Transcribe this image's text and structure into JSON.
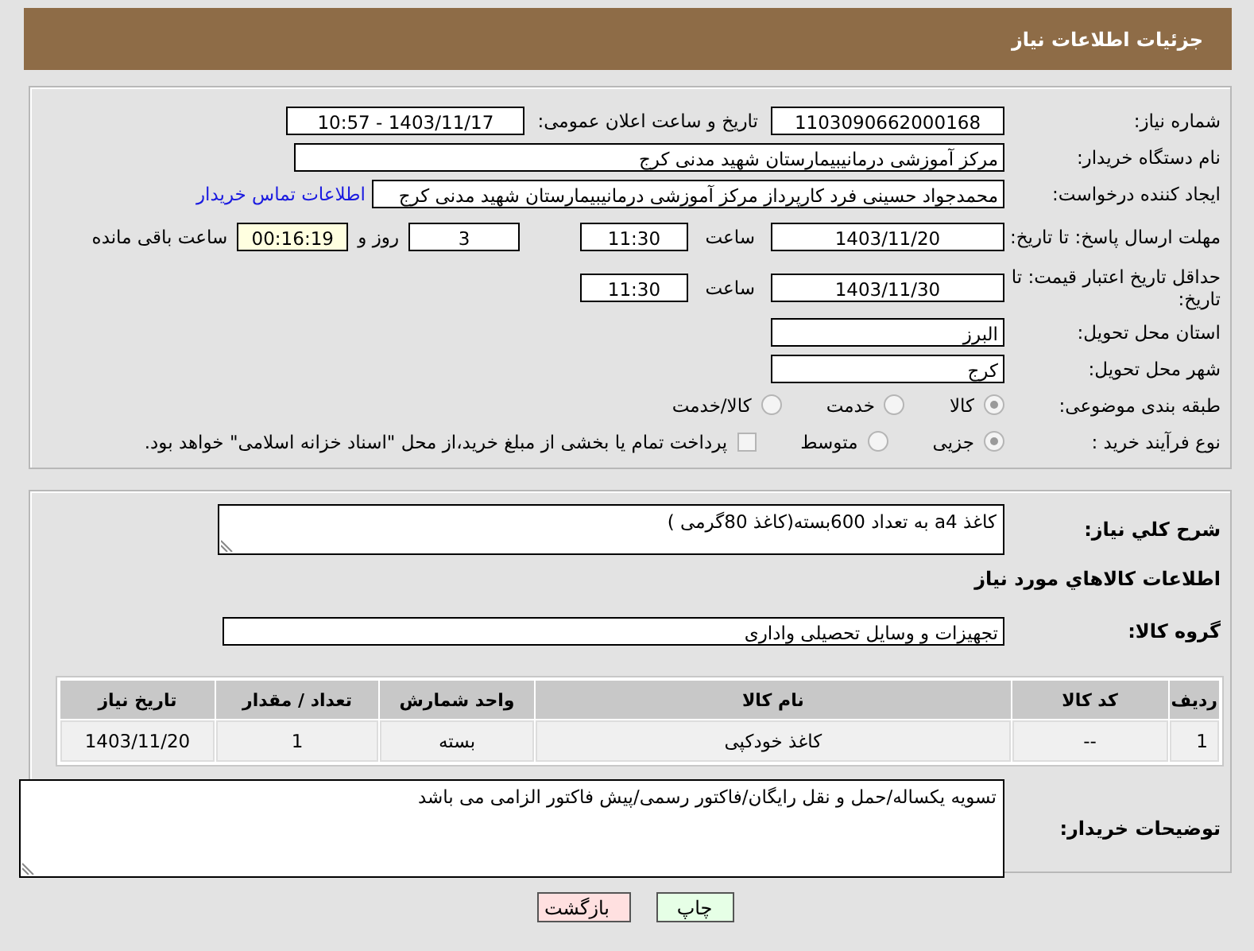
{
  "header": {
    "title": "جزئیات اطلاعات نیاز"
  },
  "need_number": {
    "label": "شماره نیاز:",
    "value": "1103090662000168"
  },
  "announce": {
    "label": "تاریخ و ساعت اعلان عمومی:",
    "value": "1403/11/17 - 10:57"
  },
  "buyer_org": {
    "label": "نام دستگاه خریدار:",
    "value": "مرکز آموزشی درمانیبیمارستان شهید مدنی کرج"
  },
  "creator": {
    "label": "ایجاد کننده درخواست:",
    "value": "محمدجواد حسینی فرد کارپرداز مرکز آموزشی درمانیبیمارستان شهید مدنی کرج",
    "link": "اطلاعات تماس خریدار"
  },
  "reply_deadline": {
    "label": "مهلت ارسال پاسخ: تا تاریخ:",
    "date": "1403/11/20",
    "time_label": "ساعت",
    "time": "11:30",
    "days": "3",
    "days_label": "روز و",
    "remaining": "00:16:19",
    "remaining_label": "ساعت باقی مانده"
  },
  "price_validity": {
    "label": "حداقل تاریخ اعتبار قیمت: تا تاریخ:",
    "date": "1403/11/30",
    "time_label": "ساعت",
    "time": "11:30"
  },
  "province": {
    "label": "استان محل تحویل:",
    "value": "البرز"
  },
  "city": {
    "label": "شهر محل تحویل:",
    "value": "کرج"
  },
  "category": {
    "label": "طبقه بندی موضوعی:",
    "options": [
      {
        "label": "کالا",
        "selected": true
      },
      {
        "label": "خدمت",
        "selected": false
      },
      {
        "label": "کالا/خدمت",
        "selected": false
      }
    ]
  },
  "purchase_type": {
    "label": "نوع فرآیند خرید :",
    "options": [
      {
        "label": "جزیی",
        "selected": true
      },
      {
        "label": "متوسط",
        "selected": false
      }
    ],
    "payment": {
      "label": "پرداخت تمام یا بخشی از مبلغ خرید،از محل \"اسناد خزانه اسلامی\" خواهد بود.",
      "checked": false
    }
  },
  "description": {
    "label": "شرح کلي نياز:",
    "value": "کاغذ a4 به تعداد 600بسته(کاغذ 80گرمی )"
  },
  "goods_heading": "اطلاعات کالاهاي مورد نياز",
  "goods_group": {
    "label": "گروه کالا:",
    "value": "تجهیزات و وسایل تحصیلی واداری"
  },
  "table": {
    "columns": [
      "ردیف",
      "کد کالا",
      "نام کالا",
      "واحد شمارش",
      "تعداد / مقدار",
      "تاریخ نیاز"
    ],
    "rows": [
      [
        "1",
        "--",
        "کاغذ خودکپی",
        "بسته",
        "1",
        "1403/11/20"
      ]
    ]
  },
  "buyer_notes": {
    "label": "توضیحات خریدار:",
    "value": "تسویه یکساله/حمل و نقل رایگان/فاکتور رسمی/پیش فاکتور الزامی می باشد"
  },
  "buttons": [
    {
      "label": "چاپ",
      "kind": "print"
    },
    {
      "label": "بازگشت",
      "kind": "back"
    }
  ]
}
